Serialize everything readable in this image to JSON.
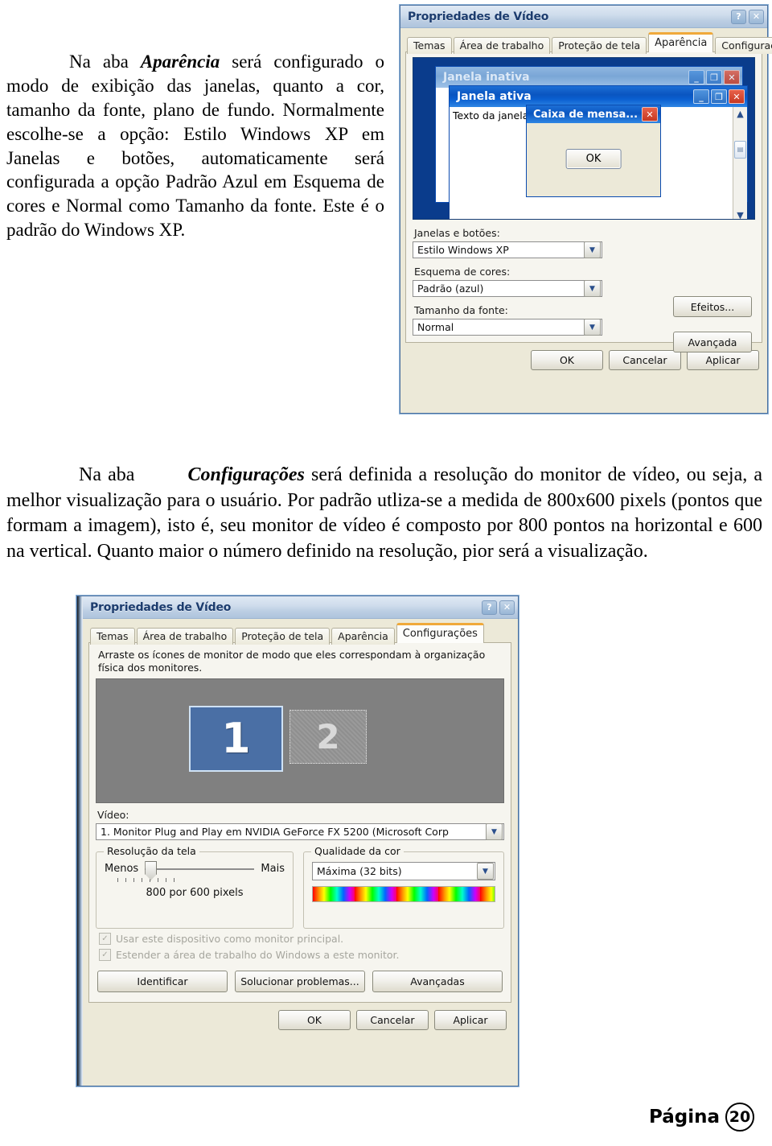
{
  "document": {
    "paragraph_1": {
      "lead": "Na aba ",
      "emphasis": "Aparência",
      "rest": " será configurado o modo de exibição das janelas, quanto a cor, tamanho da fonte, plano de fundo. Normalmente escolhe-se a opção: Estilo Windows XP em Janelas e botões, automaticamente será configurada a opção Padrão Azul em Esquema de cores e Normal como Tamanho da fonte. Este é o padrão do Windows XP."
    },
    "paragraph_2": {
      "lead": "Na aba ",
      "emphasis": "Configurações",
      "rest": " será definida a resolução do monitor de vídeo, ou seja, a melhor visualização para o usuário. Por padrão utliza-se a medida de 800x600 pixels (pontos que formam a imagem), isto é, seu monitor de vídeo é composto por 800 pontos na horizontal e 600 na vertical. Quanto maior o número definido na resolução, pior será a visualização."
    },
    "footer": {
      "label": "Página",
      "number": "20"
    }
  },
  "dialog_appearance": {
    "title": "Propriedades de Vídeo",
    "sysbuttons": {
      "help": "?",
      "close": "✕"
    },
    "tabs": [
      {
        "label": "Temas",
        "active": false
      },
      {
        "label": "Área de trabalho",
        "active": false
      },
      {
        "label": "Proteção de tela",
        "active": false
      },
      {
        "label": "Aparência",
        "active": true
      },
      {
        "label": "Configurações",
        "active": false
      }
    ],
    "preview": {
      "inactive_window_title": "Janela inativa",
      "active_window_title": "Janela ativa",
      "window_text": "Texto da janela",
      "messagebox_title": "Caixa de mensa...",
      "messagebox_ok": "OK",
      "minimize_glyph": "_",
      "maximize_glyph": "❐",
      "close_glyph": "✕",
      "scroll_up_glyph": "▲",
      "scroll_down_glyph": "▼"
    },
    "fields": [
      {
        "label": "Janelas e botões:",
        "value": "Estilo Windows XP"
      },
      {
        "label": "Esquema de cores:",
        "value": "Padrão (azul)"
      },
      {
        "label": "Tamanho da fonte:",
        "value": "Normal"
      }
    ],
    "side_buttons": [
      "Efeitos...",
      "Avançada"
    ],
    "footer_buttons": [
      "OK",
      "Cancelar",
      "Aplicar"
    ],
    "colors": {
      "desktop_blue": "#0a3c8c",
      "active_title_blue": "#0a55c0",
      "inactive_title_blue": "#7aa6d6",
      "face": "#ece9d8",
      "active_tab_accent": "#f0a93a"
    }
  },
  "dialog_settings": {
    "title": "Propriedades de Vídeo",
    "sysbuttons": {
      "help": "?",
      "close": "✕"
    },
    "tabs": [
      {
        "label": "Temas",
        "active": false
      },
      {
        "label": "Área de trabalho",
        "active": false
      },
      {
        "label": "Proteção de tela",
        "active": false
      },
      {
        "label": "Aparência",
        "active": false
      },
      {
        "label": "Configurações",
        "active": true
      }
    ],
    "hint": "Arraste os ícones de monitor de modo que eles correspondam à organização física dos monitores.",
    "monitors": [
      {
        "number": "1",
        "selected": true
      },
      {
        "number": "2",
        "selected": false
      }
    ],
    "video": {
      "label": "Vídeo:",
      "value": "1. Monitor Plug and Play em NVIDIA GeForce FX 5200  (Microsoft Corp"
    },
    "screen_resolution": {
      "caption": "Resolução da tela",
      "less_label": "Menos",
      "more_label": "Mais",
      "value": "800 por 600 pixels",
      "tick_count": 8,
      "thumb_position_percent": 8
    },
    "color_quality": {
      "caption": "Qualidade da cor",
      "value": "Máxima (32 bits)"
    },
    "checkboxes": [
      {
        "label": "Usar este dispositivo como monitor principal.",
        "checked": true,
        "disabled": true
      },
      {
        "label": "Estender a área de trabalho do Windows a este monitor.",
        "checked": true,
        "disabled": true
      }
    ],
    "action_buttons": [
      "Identificar",
      "Solucionar problemas...",
      "Avançadas"
    ],
    "footer_buttons": [
      "OK",
      "Cancelar",
      "Aplicar"
    ],
    "colors": {
      "monitor_pane_gray": "#808080",
      "monitor_selected_blue": "#4a6fa5",
      "active_tab_accent": "#f0a93a"
    }
  }
}
